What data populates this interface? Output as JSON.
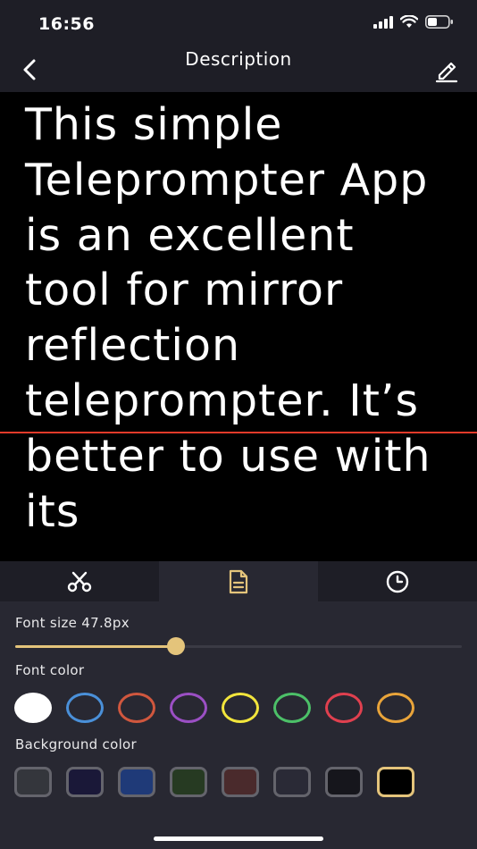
{
  "status": {
    "time": "16:56"
  },
  "nav": {
    "title": "Description"
  },
  "script": {
    "text": "This simple Teleprompter App is an excellent tool for mirror reflection teleprompter. It’s better to use with its"
  },
  "tabs": [
    {
      "name": "tab-edit-script",
      "icon": "scissors-icon",
      "active": false
    },
    {
      "name": "tab-text-settings",
      "icon": "document-icon",
      "active": true
    },
    {
      "name": "tab-timer",
      "icon": "clock-icon",
      "active": false
    }
  ],
  "settings": {
    "font_size_label": "Font size 47.8px",
    "font_size_fraction": 0.36,
    "font_color_label": "Font color",
    "background_color_label": "Background color",
    "font_colors": [
      "#ffffff",
      "#4a90d9",
      "#d0573e",
      "#9b4fc4",
      "#f2e53c",
      "#4cc068",
      "#e0404f",
      "#e9a43a"
    ],
    "font_color_selected": 0,
    "background_colors": [
      "#34363c",
      "#1a1838",
      "#1f3a78",
      "#263a22",
      "#4a2a2c",
      "#2a2a36",
      "#16161c",
      "#000000"
    ],
    "background_color_selected": 7,
    "accent_color": "#e4c47b"
  }
}
